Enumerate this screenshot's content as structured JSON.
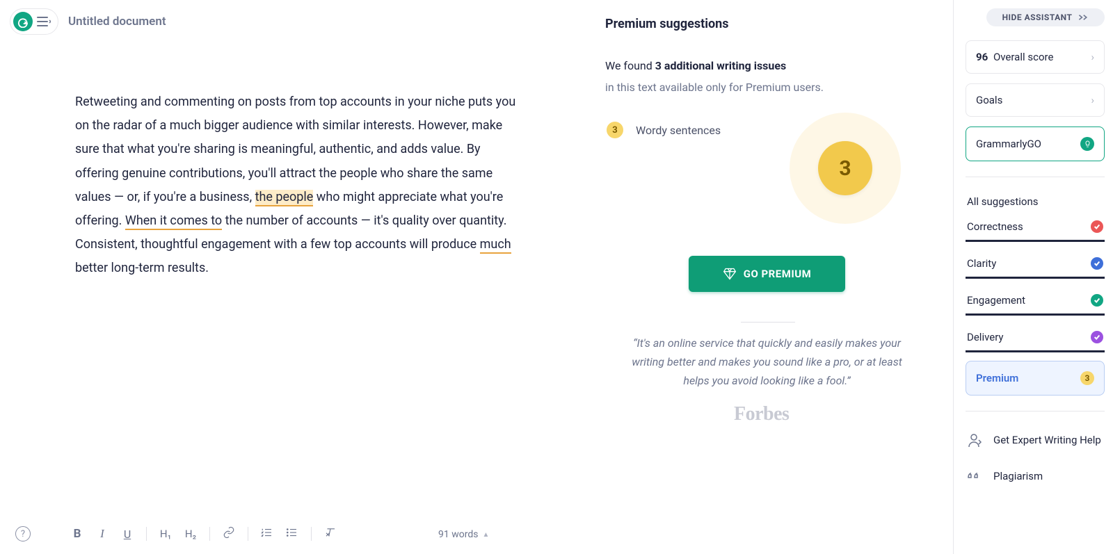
{
  "header": {
    "doc_title": "Untitled document"
  },
  "editor": {
    "p_a": "Retweeting and commenting on posts from top accounts in your niche puts you on the radar of a much bigger audience with similar interests. However, make sure that what you're sharing is meaningful, authentic, and adds value. By offering genuine contributions, you'll attract the people who share the same values — or, if you're a business, ",
    "hl_people": "the people",
    "p_b": " who might appreciate what you're offering. ",
    "ul_when": "When it comes to",
    "p_c": " the number of accounts — it's quality over quantity. Consistent, thoughtful engagement with a few top accounts will produce ",
    "ul_much": "much",
    "p_d": " better long-term results."
  },
  "toolbar": {
    "bold": "B",
    "italic": "I",
    "underline": "U",
    "h1": "H₁",
    "h2": "H₂",
    "word_count": "91 words"
  },
  "suggestions": {
    "title": "Premium suggestions",
    "found_prefix": "We found ",
    "found_bold": "3 additional writing issues",
    "note": "in this text available only for Premium users.",
    "wordy_count": "3",
    "wordy_label": "Wordy sentences",
    "big_count": "3",
    "go_premium": "GO PREMIUM",
    "quote": "“It's an online service that quickly and easily makes your writing better and makes you sound like a pro, or at least helps you avoid looking like a fool.”",
    "forbes": "Forbes"
  },
  "sidebar": {
    "hide": "HIDE ASSISTANT",
    "score_value": "96",
    "score_label": " Overall score",
    "goals": "Goals",
    "ggo": "GrammarlyGO",
    "all": "All suggestions",
    "correctness": "Correctness",
    "clarity": "Clarity",
    "engagement": "Engagement",
    "delivery": "Delivery",
    "premium": "Premium",
    "premium_count": "3",
    "expert": "Get Expert Writing Help",
    "plagiarism": "Plagiarism"
  }
}
